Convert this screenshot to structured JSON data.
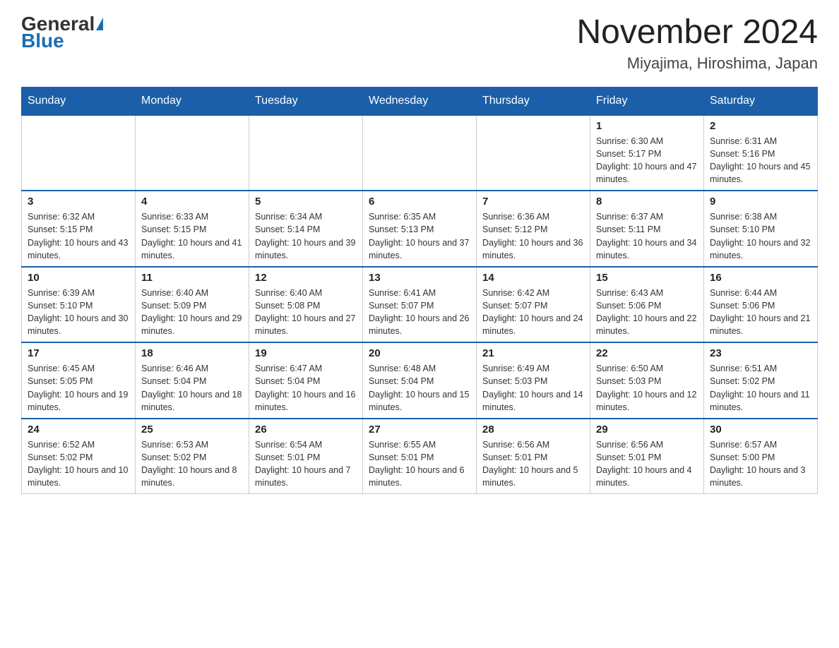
{
  "header": {
    "logo_general": "General",
    "logo_blue": "Blue",
    "month_year": "November 2024",
    "location": "Miyajima, Hiroshima, Japan"
  },
  "days_of_week": [
    "Sunday",
    "Monday",
    "Tuesday",
    "Wednesday",
    "Thursday",
    "Friday",
    "Saturday"
  ],
  "weeks": [
    [
      {
        "day": "",
        "info": ""
      },
      {
        "day": "",
        "info": ""
      },
      {
        "day": "",
        "info": ""
      },
      {
        "day": "",
        "info": ""
      },
      {
        "day": "",
        "info": ""
      },
      {
        "day": "1",
        "info": "Sunrise: 6:30 AM\nSunset: 5:17 PM\nDaylight: 10 hours and 47 minutes."
      },
      {
        "day": "2",
        "info": "Sunrise: 6:31 AM\nSunset: 5:16 PM\nDaylight: 10 hours and 45 minutes."
      }
    ],
    [
      {
        "day": "3",
        "info": "Sunrise: 6:32 AM\nSunset: 5:15 PM\nDaylight: 10 hours and 43 minutes."
      },
      {
        "day": "4",
        "info": "Sunrise: 6:33 AM\nSunset: 5:15 PM\nDaylight: 10 hours and 41 minutes."
      },
      {
        "day": "5",
        "info": "Sunrise: 6:34 AM\nSunset: 5:14 PM\nDaylight: 10 hours and 39 minutes."
      },
      {
        "day": "6",
        "info": "Sunrise: 6:35 AM\nSunset: 5:13 PM\nDaylight: 10 hours and 37 minutes."
      },
      {
        "day": "7",
        "info": "Sunrise: 6:36 AM\nSunset: 5:12 PM\nDaylight: 10 hours and 36 minutes."
      },
      {
        "day": "8",
        "info": "Sunrise: 6:37 AM\nSunset: 5:11 PM\nDaylight: 10 hours and 34 minutes."
      },
      {
        "day": "9",
        "info": "Sunrise: 6:38 AM\nSunset: 5:10 PM\nDaylight: 10 hours and 32 minutes."
      }
    ],
    [
      {
        "day": "10",
        "info": "Sunrise: 6:39 AM\nSunset: 5:10 PM\nDaylight: 10 hours and 30 minutes."
      },
      {
        "day": "11",
        "info": "Sunrise: 6:40 AM\nSunset: 5:09 PM\nDaylight: 10 hours and 29 minutes."
      },
      {
        "day": "12",
        "info": "Sunrise: 6:40 AM\nSunset: 5:08 PM\nDaylight: 10 hours and 27 minutes."
      },
      {
        "day": "13",
        "info": "Sunrise: 6:41 AM\nSunset: 5:07 PM\nDaylight: 10 hours and 26 minutes."
      },
      {
        "day": "14",
        "info": "Sunrise: 6:42 AM\nSunset: 5:07 PM\nDaylight: 10 hours and 24 minutes."
      },
      {
        "day": "15",
        "info": "Sunrise: 6:43 AM\nSunset: 5:06 PM\nDaylight: 10 hours and 22 minutes."
      },
      {
        "day": "16",
        "info": "Sunrise: 6:44 AM\nSunset: 5:06 PM\nDaylight: 10 hours and 21 minutes."
      }
    ],
    [
      {
        "day": "17",
        "info": "Sunrise: 6:45 AM\nSunset: 5:05 PM\nDaylight: 10 hours and 19 minutes."
      },
      {
        "day": "18",
        "info": "Sunrise: 6:46 AM\nSunset: 5:04 PM\nDaylight: 10 hours and 18 minutes."
      },
      {
        "day": "19",
        "info": "Sunrise: 6:47 AM\nSunset: 5:04 PM\nDaylight: 10 hours and 16 minutes."
      },
      {
        "day": "20",
        "info": "Sunrise: 6:48 AM\nSunset: 5:04 PM\nDaylight: 10 hours and 15 minutes."
      },
      {
        "day": "21",
        "info": "Sunrise: 6:49 AM\nSunset: 5:03 PM\nDaylight: 10 hours and 14 minutes."
      },
      {
        "day": "22",
        "info": "Sunrise: 6:50 AM\nSunset: 5:03 PM\nDaylight: 10 hours and 12 minutes."
      },
      {
        "day": "23",
        "info": "Sunrise: 6:51 AM\nSunset: 5:02 PM\nDaylight: 10 hours and 11 minutes."
      }
    ],
    [
      {
        "day": "24",
        "info": "Sunrise: 6:52 AM\nSunset: 5:02 PM\nDaylight: 10 hours and 10 minutes."
      },
      {
        "day": "25",
        "info": "Sunrise: 6:53 AM\nSunset: 5:02 PM\nDaylight: 10 hours and 8 minutes."
      },
      {
        "day": "26",
        "info": "Sunrise: 6:54 AM\nSunset: 5:01 PM\nDaylight: 10 hours and 7 minutes."
      },
      {
        "day": "27",
        "info": "Sunrise: 6:55 AM\nSunset: 5:01 PM\nDaylight: 10 hours and 6 minutes."
      },
      {
        "day": "28",
        "info": "Sunrise: 6:56 AM\nSunset: 5:01 PM\nDaylight: 10 hours and 5 minutes."
      },
      {
        "day": "29",
        "info": "Sunrise: 6:56 AM\nSunset: 5:01 PM\nDaylight: 10 hours and 4 minutes."
      },
      {
        "day": "30",
        "info": "Sunrise: 6:57 AM\nSunset: 5:00 PM\nDaylight: 10 hours and 3 minutes."
      }
    ]
  ]
}
